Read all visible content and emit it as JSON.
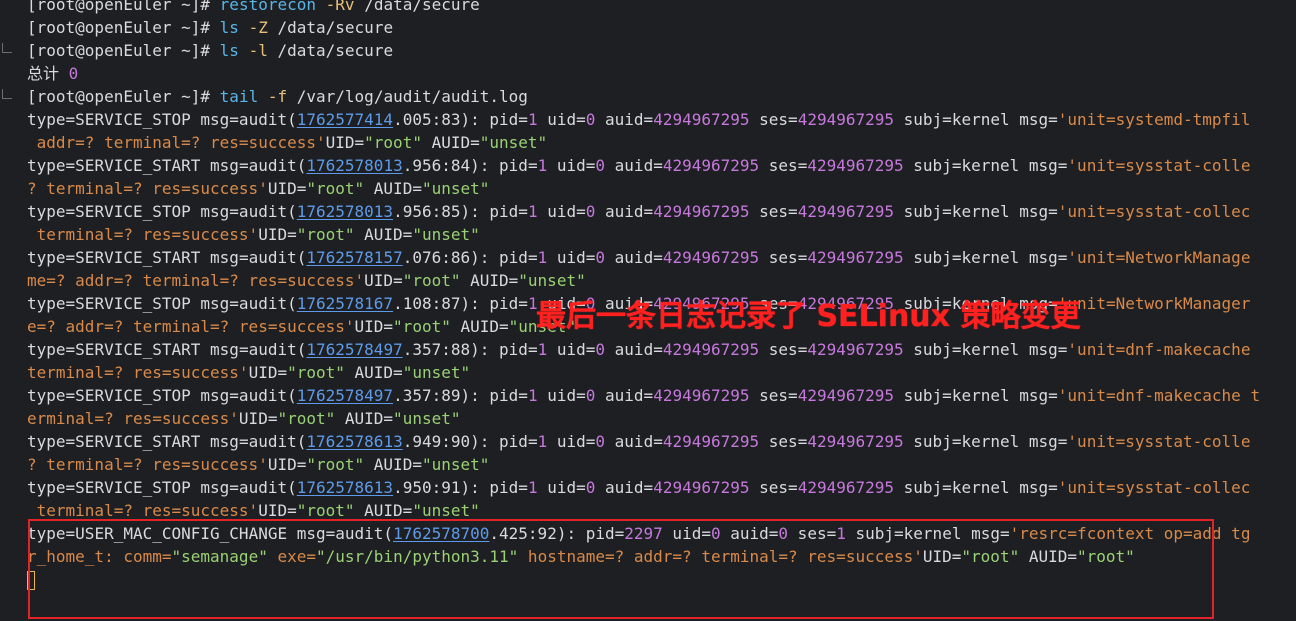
{
  "terminal": {
    "lines": [
      {
        "kind": "cmd",
        "prompt": "[root@openEuler ~]#",
        "cmd": "restorecon",
        "flag": "-Rv",
        "arg": "/data/secure"
      },
      {
        "kind": "cmd",
        "prompt": "[root@openEuler ~]#",
        "cmd": "ls",
        "flag": "-Z",
        "arg": "/data/secure"
      },
      {
        "kind": "cmd",
        "prompt": "[root@openEuler ~]#",
        "cmd": "ls",
        "flag": "-l",
        "arg": "/data/secure"
      },
      {
        "kind": "total",
        "label": "总计",
        "value": "0"
      },
      {
        "kind": "cmd",
        "prompt": "[root@openEuler ~]#",
        "cmd": "tail",
        "flag": "-f",
        "arg": "/var/log/audit/audit.log"
      },
      {
        "kind": "audit",
        "type": "SERVICE_STOP",
        "ts": "1762577414",
        "ms": ".005",
        "seq": ":83",
        "pid": "1",
        "uid": "0",
        "auid": "4294967295",
        "ses": "4294967295",
        "subj": "kernel",
        "msg_start": "'unit=systemd-tmpfil"
      },
      {
        "kind": "cont",
        "text": " addr=? terminal=? res=success'",
        "uid_val": "\"root\"",
        "auid_val": "\"unset\""
      },
      {
        "kind": "audit",
        "type": "SERVICE_START",
        "ts": "1762578013",
        "ms": ".956",
        "seq": ":84",
        "pid": "1",
        "uid": "0",
        "auid": "4294967295",
        "ses": "4294967295",
        "subj": "kernel",
        "msg_start": "'unit=sysstat-colle"
      },
      {
        "kind": "cont",
        "text": "? terminal=? res=success'",
        "uid_val": "\"root\"",
        "auid_val": "\"unset\""
      },
      {
        "kind": "audit",
        "type": "SERVICE_STOP",
        "ts": "1762578013",
        "ms": ".956",
        "seq": ":85",
        "pid": "1",
        "uid": "0",
        "auid": "4294967295",
        "ses": "4294967295",
        "subj": "kernel",
        "msg_start": "'unit=sysstat-collec"
      },
      {
        "kind": "cont",
        "text": " terminal=? res=success'",
        "uid_val": "\"root\"",
        "auid_val": "\"unset\""
      },
      {
        "kind": "audit",
        "type": "SERVICE_START",
        "ts": "1762578157",
        "ms": ".076",
        "seq": ":86",
        "pid": "1",
        "uid": "0",
        "auid": "4294967295",
        "ses": "4294967295",
        "subj": "kernel",
        "msg_start": "'unit=NetworkManage"
      },
      {
        "kind": "cont",
        "text": "me=? addr=? terminal=? res=success'",
        "uid_val": "\"root\"",
        "auid_val": "\"unset\""
      },
      {
        "kind": "audit",
        "type": "SERVICE_STOP",
        "ts": "1762578167",
        "ms": ".108",
        "seq": ":87",
        "pid": "1",
        "uid": "0",
        "auid": "4294967295",
        "ses": "4294967295",
        "subj": "kernel",
        "msg_start": "'unit=NetworkManager"
      },
      {
        "kind": "cont",
        "text": "e=? addr=? terminal=? res=success'",
        "uid_val": "\"root\"",
        "auid_val": "\"unset\""
      },
      {
        "kind": "audit",
        "type": "SERVICE_START",
        "ts": "1762578497",
        "ms": ".357",
        "seq": ":88",
        "pid": "1",
        "uid": "0",
        "auid": "4294967295",
        "ses": "4294967295",
        "subj": "kernel",
        "msg_start": "'unit=dnf-makecache"
      },
      {
        "kind": "cont",
        "text": "terminal=? res=success'",
        "uid_val": "\"root\"",
        "auid_val": "\"unset\""
      },
      {
        "kind": "audit",
        "type": "SERVICE_STOP",
        "ts": "1762578497",
        "ms": ".357",
        "seq": ":89",
        "pid": "1",
        "uid": "0",
        "auid": "4294967295",
        "ses": "4294967295",
        "subj": "kernel",
        "msg_start": "'unit=dnf-makecache t"
      },
      {
        "kind": "cont",
        "text": "erminal=? res=success'",
        "uid_val": "\"root\"",
        "auid_val": "\"unset\""
      },
      {
        "kind": "audit",
        "type": "SERVICE_START",
        "ts": "1762578613",
        "ms": ".949",
        "seq": ":90",
        "pid": "1",
        "uid": "0",
        "auid": "4294967295",
        "ses": "4294967295",
        "subj": "kernel",
        "msg_start": "'unit=sysstat-colle"
      },
      {
        "kind": "cont",
        "text": "? terminal=? res=success'",
        "uid_val": "\"root\"",
        "auid_val": "\"unset\""
      },
      {
        "kind": "audit",
        "type": "SERVICE_STOP",
        "ts": "1762578613",
        "ms": ".950",
        "seq": ":91",
        "pid": "1",
        "uid": "0",
        "auid": "4294967295",
        "ses": "4294967295",
        "subj": "kernel",
        "msg_start": "'unit=sysstat-collec"
      },
      {
        "kind": "cont",
        "text": " terminal=? res=success'",
        "uid_val": "\"root\"",
        "auid_val": "\"unset\""
      },
      {
        "kind": "audit",
        "type": "USER_MAC_CONFIG_CHANGE",
        "ts": "1762578700",
        "ms": ".425",
        "seq": ":92",
        "pid": "2297",
        "uid": "0",
        "auid": "0",
        "ses": "1",
        "subj": "kernel",
        "msg_start": "'resrc=fcontext op=add tg"
      },
      {
        "kind": "cont2",
        "pre": "r_home_t: comm=",
        "comm": "\"semanage\"",
        "exe_label": " exe=",
        "exe": "\"/usr/bin/python3.11\"",
        "rest": " hostname=? addr=? terminal=? res=success'",
        "uid_val": "\"root\"",
        "auid_val": "\"root\""
      },
      {
        "kind": "cursor"
      }
    ]
  },
  "annotation": {
    "text": "最后一条日志记录了 SELinux 策略变更",
    "color": "#ff2020"
  },
  "colors": {
    "background": "#1e1f22",
    "command": "#58b6e8",
    "flag": "#e6c07b",
    "number": "#c678dd",
    "timestamp": "#5d9bea",
    "string": "#9ad175",
    "highlight_box": "#e0242a"
  }
}
